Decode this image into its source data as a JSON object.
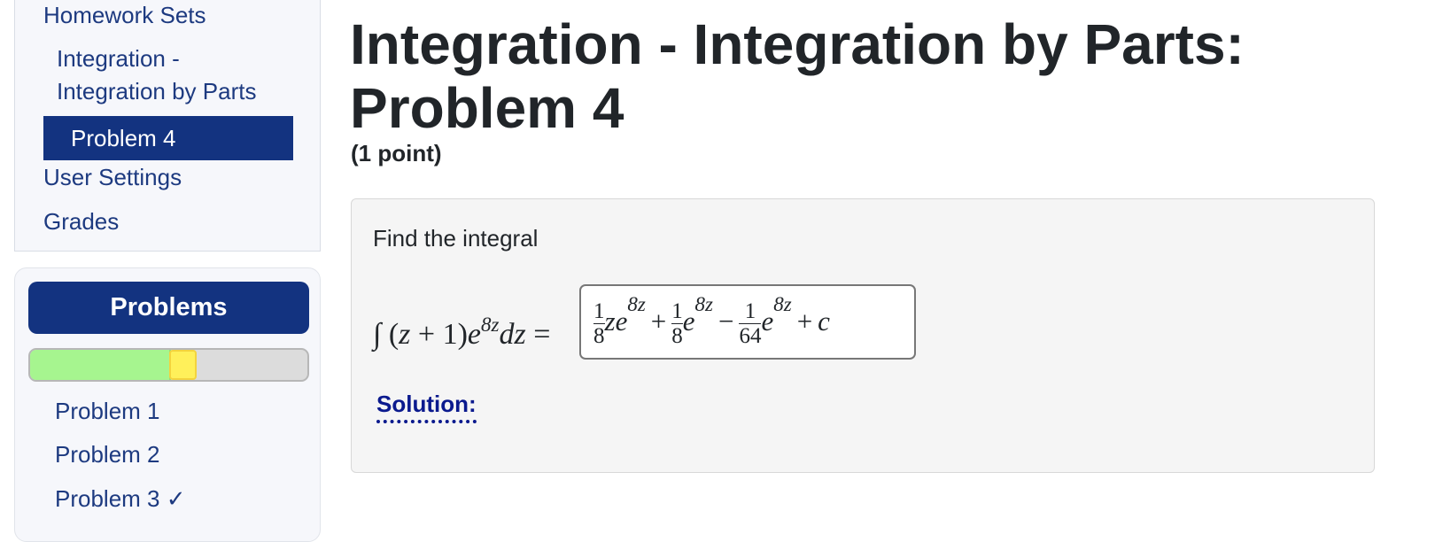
{
  "sidebar": {
    "homework_sets": "Homework Sets",
    "set_name_line1": "Integration -",
    "set_name_line2": "Integration by Parts",
    "active_problem": "Problem 4",
    "user_settings": "User Settings",
    "grades": "Grades"
  },
  "problems_panel": {
    "header": "Problems",
    "progress": {
      "correct_fraction": 0.5,
      "partial_fraction": 0.1
    },
    "items": [
      "Problem 1",
      "Problem 2",
      "Problem 3 ✓"
    ]
  },
  "main": {
    "title": "Integration - Integration by Parts: Problem 4",
    "points": "(1 point)",
    "prompt": "Find the integral",
    "equation": {
      "integral_sign": "∫",
      "open": "(",
      "z": "z",
      "plus": "+",
      "one": "1",
      "close": ")",
      "e": "e",
      "exponent": "8z",
      "dz": "dz",
      "equals": "="
    },
    "answer": {
      "frac1_num": "1",
      "frac1_den": "8",
      "term1": "ze",
      "exp1": "8z",
      "plus": "+",
      "frac2_num": "1",
      "frac2_den": "8",
      "term2": "e",
      "exp2": "8z",
      "minus": "−",
      "frac3_num": "1",
      "frac3_den": "64",
      "term3": "e",
      "exp3": "8z",
      "plus2": "+",
      "constant": "c"
    },
    "solution_label": "Solution:"
  },
  "colors": {
    "brand": "#133380",
    "link": "#1d3a80",
    "solution_link": "#0b1a8e",
    "progress_correct": "#a6f58f",
    "progress_partial": "#fff05a"
  }
}
